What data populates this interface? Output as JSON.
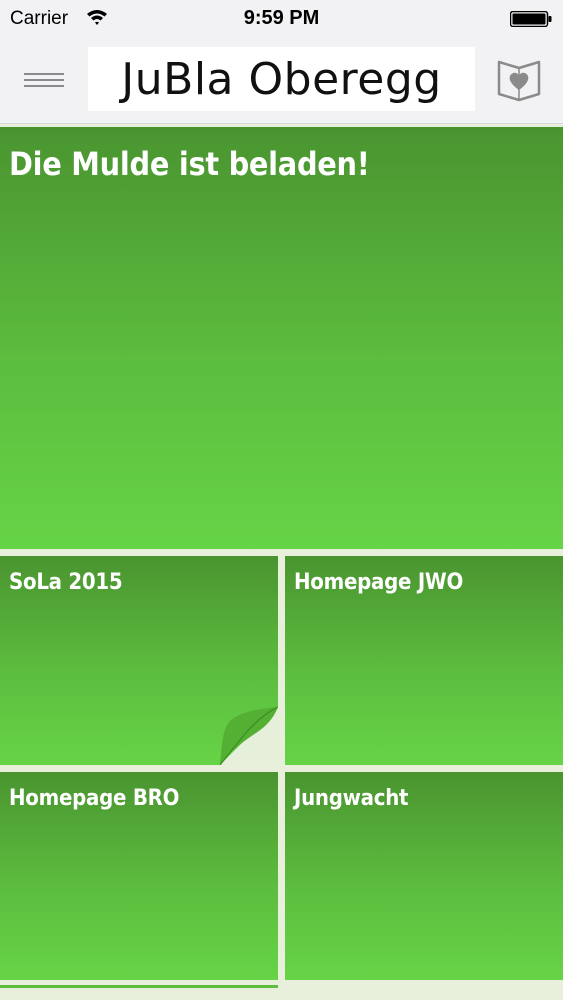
{
  "status_bar": {
    "carrier": "Carrier",
    "time": "9:59 PM",
    "wifi_icon": "wifi-icon",
    "battery_icon": "battery-icon"
  },
  "nav_bar": {
    "title": "JuBla Oberegg",
    "menu_icon": "hamburger-menu-icon",
    "favorites_icon": "heart-book-icon"
  },
  "tiles": [
    {
      "title": "Die Mulde ist beladen!"
    },
    {
      "title": "SoLa 2015"
    },
    {
      "title": "Homepage JWO"
    },
    {
      "title": "Homepage BRO"
    },
    {
      "title": "Jungwacht"
    }
  ],
  "colors": {
    "tile_gradient_top": "#4a9430",
    "tile_gradient_bottom": "#66d447",
    "background": "#e8f0dc",
    "nav_background": "#f2f2f4"
  }
}
